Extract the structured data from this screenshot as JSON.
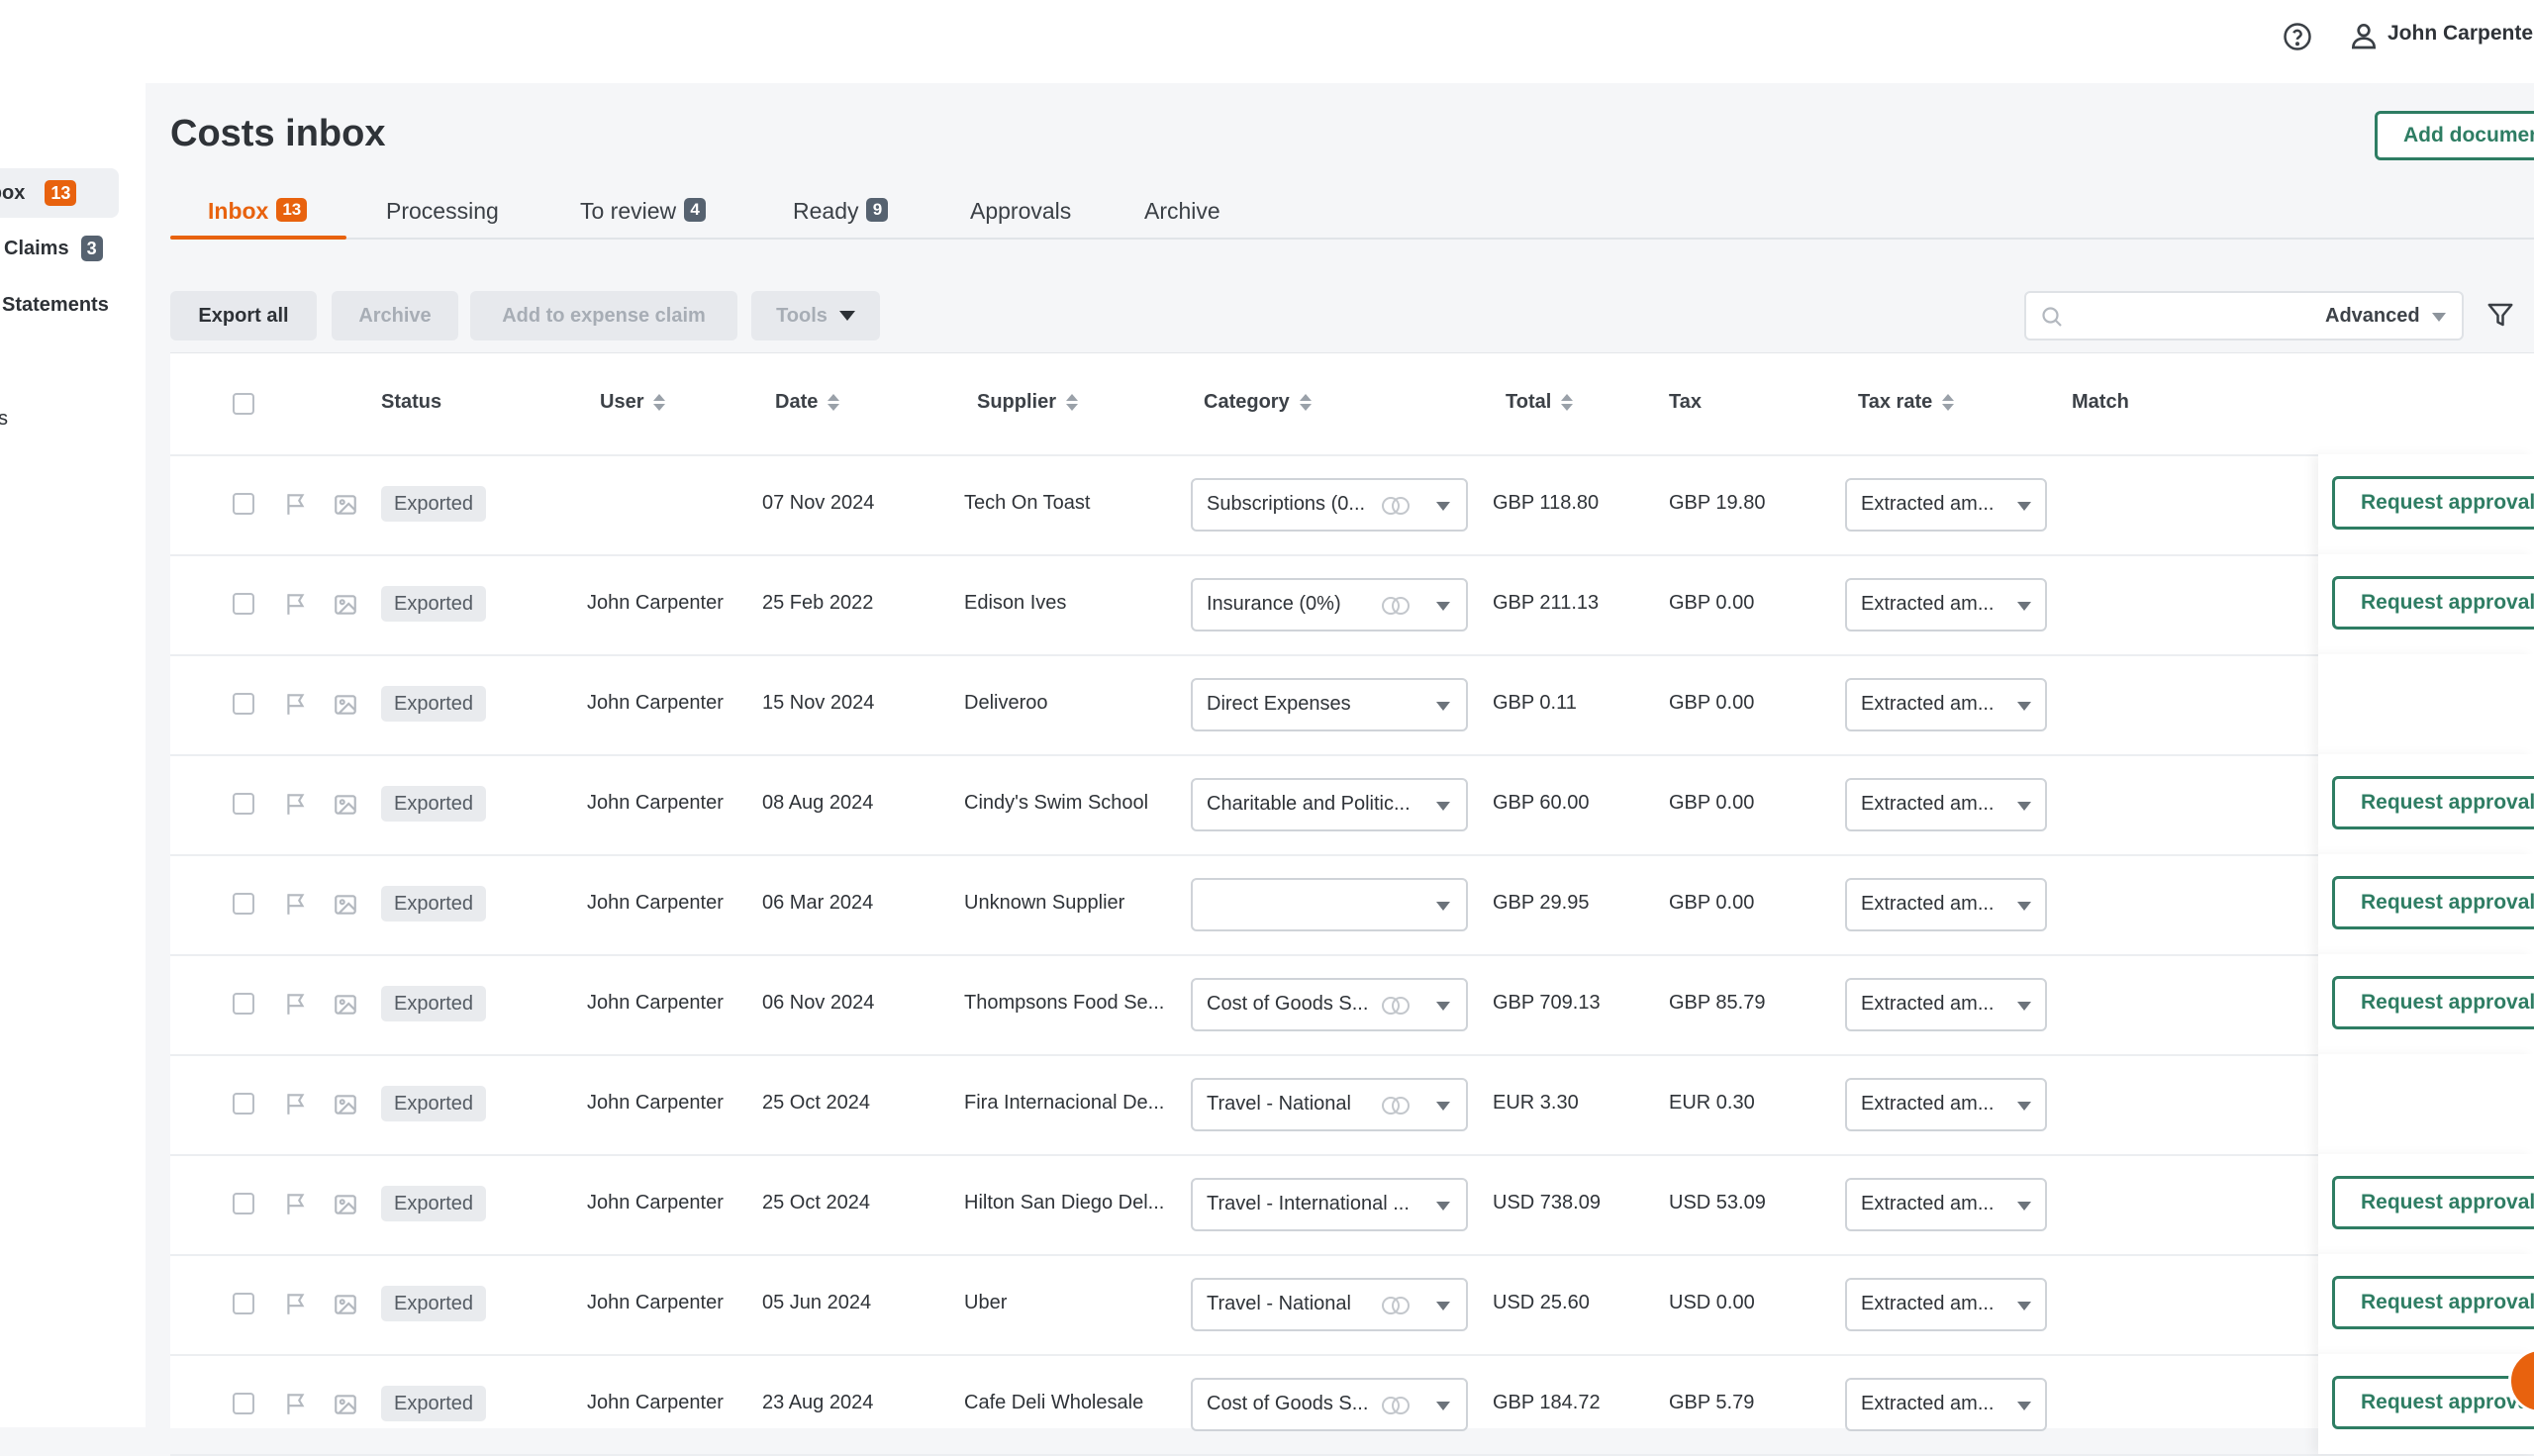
{
  "header": {
    "user_name": "John Carpenter"
  },
  "sidebar": {
    "items": [
      {
        "label": "Inbox",
        "badge": "13",
        "badge_color": "#e8620e",
        "active": true
      },
      {
        "label": "Claims",
        "badge": "3",
        "badge_color": "#566270"
      },
      {
        "label": "Statements",
        "badge": ""
      },
      {
        "label": "s",
        "badge": ""
      }
    ]
  },
  "page": {
    "title": "Costs inbox",
    "add_document_label": "Add document"
  },
  "tabs": [
    {
      "label": "Inbox",
      "badge": "13",
      "active": true
    },
    {
      "label": "Processing",
      "badge": ""
    },
    {
      "label": "To review",
      "badge": "4"
    },
    {
      "label": "Ready",
      "badge": "9"
    },
    {
      "label": "Approvals",
      "badge": ""
    },
    {
      "label": "Archive",
      "badge": ""
    }
  ],
  "toolbar": {
    "export_all": "Export all",
    "archive": "Archive",
    "add_to_claim": "Add to expense claim",
    "tools": "Tools",
    "search_placeholder": "",
    "advanced": "Advanced"
  },
  "table": {
    "columns": {
      "status": "Status",
      "user": "User",
      "date": "Date",
      "supplier": "Supplier",
      "category": "Category",
      "total": "Total",
      "tax": "Tax",
      "tax_rate": "Tax rate",
      "match": "Match"
    },
    "rows": [
      {
        "status": "Exported",
        "user": "",
        "date": "07 Nov 2024",
        "supplier": "Tech On Toast",
        "category": "Subscriptions (0...",
        "ai": true,
        "total": "GBP 118.80",
        "tax": "GBP 19.80",
        "tax_rate": "Extracted am...",
        "action": "Request approval"
      },
      {
        "status": "Exported",
        "user": "John Carpenter",
        "date": "25 Feb 2022",
        "supplier": "Edison Ives",
        "category": "Insurance (0%)",
        "ai": true,
        "total": "GBP 211.13",
        "tax": "GBP 0.00",
        "tax_rate": "Extracted am...",
        "action": "Request approval"
      },
      {
        "status": "Exported",
        "user": "John Carpenter",
        "date": "15 Nov 2024",
        "supplier": "Deliveroo",
        "category": "Direct Expenses",
        "ai": false,
        "total": "GBP 0.11",
        "tax": "GBP 0.00",
        "tax_rate": "Extracted am...",
        "action": ""
      },
      {
        "status": "Exported",
        "user": "John Carpenter",
        "date": "08 Aug 2024",
        "supplier": "Cindy's Swim School",
        "category": "Charitable and Politic...",
        "ai": false,
        "total": "GBP 60.00",
        "tax": "GBP 0.00",
        "tax_rate": "Extracted am...",
        "action": "Request approval"
      },
      {
        "status": "Exported",
        "user": "John Carpenter",
        "date": "06 Mar 2024",
        "supplier": "Unknown Supplier",
        "category": "",
        "ai": false,
        "total": "GBP 29.95",
        "tax": "GBP 0.00",
        "tax_rate": "Extracted am...",
        "action": "Request approval"
      },
      {
        "status": "Exported",
        "user": "John Carpenter",
        "date": "06 Nov 2024",
        "supplier": "Thompsons Food Se...",
        "category": "Cost of Goods S...",
        "ai": true,
        "total": "GBP 709.13",
        "tax": "GBP 85.79",
        "tax_rate": "Extracted am...",
        "action": "Request approval"
      },
      {
        "status": "Exported",
        "user": "John Carpenter",
        "date": "25 Oct 2024",
        "supplier": "Fira Internacional De...",
        "category": "Travel - National",
        "ai": true,
        "total": "EUR 3.30",
        "tax": "EUR 0.30",
        "tax_rate": "Extracted am...",
        "action": ""
      },
      {
        "status": "Exported",
        "user": "John Carpenter",
        "date": "25 Oct 2024",
        "supplier": "Hilton San Diego Del...",
        "category": "Travel - International ...",
        "ai": false,
        "total": "USD 738.09",
        "tax": "USD 53.09",
        "tax_rate": "Extracted am...",
        "action": "Request approval"
      },
      {
        "status": "Exported",
        "user": "John Carpenter",
        "date": "05 Jun 2024",
        "supplier": "Uber",
        "category": "Travel - National",
        "ai": true,
        "total": "USD 25.60",
        "tax": "USD 0.00",
        "tax_rate": "Extracted am...",
        "action": "Request approval"
      },
      {
        "status": "Exported",
        "user": "John Carpenter",
        "date": "23 Aug 2024",
        "supplier": "Cafe Deli Wholesale",
        "category": "Cost of Goods S...",
        "ai": true,
        "total": "GBP 184.72",
        "tax": "GBP 5.79",
        "tax_rate": "Extracted am...",
        "action": "Request approval"
      }
    ]
  },
  "colors": {
    "accent": "#e8620e",
    "primary_green": "#2e7d63"
  }
}
